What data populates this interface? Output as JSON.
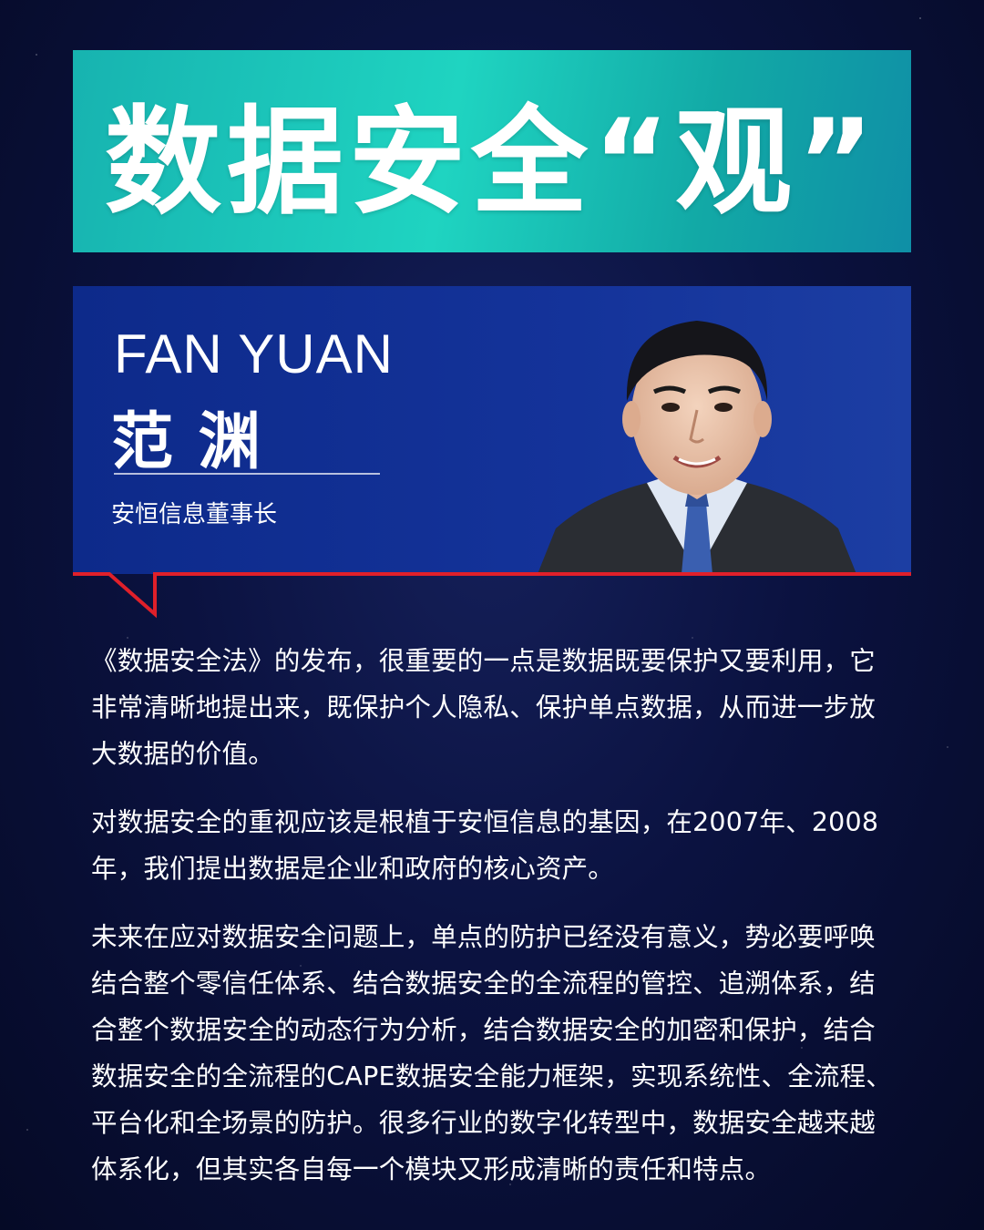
{
  "header": {
    "title": "数据安全“观”"
  },
  "profile": {
    "name_en": "FAN YUAN",
    "name_cn": "范  渊",
    "job_title": "安恒信息董事长"
  },
  "body": {
    "paragraphs": [
      "《数据安全法》的发布，很重要的一点是数据既要保护又要利用，它非常清晰地提出来，既保护个人隐私、保护单点数据，从而进一步放大数据的价值。",
      "对数据安全的重视应该是根植于安恒信息的基因，在2007年、2008年，我们提出数据是企业和政府的核心资产。",
      "未来在应对数据安全问题上，单点的防护已经没有意义，势必要呼唤结合整个零信任体系、结合数据安全的全流程的管控、追溯体系，结合整个数据安全的动态行为分析，结合数据安全的加密和保护，结合数据安全的全流程的CAPE数据安全能力框架，实现系统性、全流程、平台化和全场景的防护。很多行业的数字化转型中，数据安全越来越体系化，但其实各自每一个模块又形成清晰的责任和特点。"
    ]
  },
  "colors": {
    "background": "#0b1240",
    "title_box": "#1fd4c1",
    "profile_box": "#14339a",
    "callout_line": "#e0202a"
  }
}
